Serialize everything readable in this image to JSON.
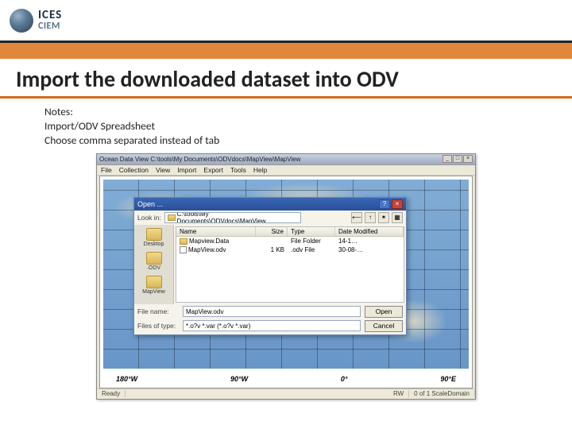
{
  "logo": {
    "top": "ICES",
    "bottom": "CIEM"
  },
  "title": "Import the downloaded dataset into ODV",
  "notes": {
    "line1": "Notes:",
    "line2": "Import/ODV Spreadsheet",
    "line3": "Choose comma separated instead of tab"
  },
  "odv": {
    "window_title": "Ocean Data View  C:\\tools\\My Documents\\ODVdocs\\MapView\\MapView",
    "menu": [
      "File",
      "Collection",
      "View",
      "Import",
      "Export",
      "Tools",
      "Help"
    ],
    "axis": [
      "180°W",
      "90°W",
      "0°",
      "90°E"
    ],
    "status": {
      "left": "Ready",
      "mid": "RW",
      "right": "0 of 1 ScaleDomain"
    }
  },
  "dialog": {
    "title": "Open ...",
    "lookin_label": "Look in:",
    "path": "C:\\tools\\My Documents\\ODVdocs\\MapView",
    "tb_icons": [
      "⟵",
      "↑",
      "✶",
      "▦"
    ],
    "places": [
      "Desktop",
      ".ODV",
      "MapView"
    ],
    "columns": {
      "name": "Name",
      "size": "Size",
      "type": "Type",
      "date": "Date Modified"
    },
    "rows": [
      {
        "name": "Mapview.Data",
        "size": "",
        "type": "File Folder",
        "date": "14-1…"
      },
      {
        "name": "MapView.odv",
        "size": "1 KB",
        "type": ".odv File",
        "date": "30-08-…"
      }
    ],
    "filename_label": "File name:",
    "filename_value": "MapView.odv",
    "filetype_label": "Files of type:",
    "filetype_value": "*.o?v *.var (*.o?v *.var)",
    "open": "Open",
    "cancel": "Cancel"
  }
}
